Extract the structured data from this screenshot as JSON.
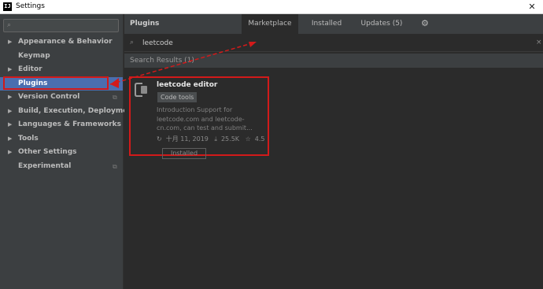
{
  "window": {
    "title": "Settings",
    "icon_label": "IJ"
  },
  "sidebar": {
    "search_placeholder": "",
    "items": [
      {
        "label": "Appearance & Behavior",
        "expandable": true
      },
      {
        "label": "Keymap",
        "expandable": false
      },
      {
        "label": "Editor",
        "expandable": true
      },
      {
        "label": "Plugins",
        "expandable": false,
        "selected": true
      },
      {
        "label": "Version Control",
        "expandable": true,
        "page_icon": true
      },
      {
        "label": "Build, Execution, Deployment",
        "expandable": true
      },
      {
        "label": "Languages & Frameworks",
        "expandable": true
      },
      {
        "label": "Tools",
        "expandable": true
      },
      {
        "label": "Other Settings",
        "expandable": true
      },
      {
        "label": "Experimental",
        "expandable": false,
        "page_icon": true
      }
    ]
  },
  "main": {
    "title": "Plugins",
    "tabs": [
      {
        "label": "Marketplace",
        "active": true
      },
      {
        "label": "Installed",
        "active": false
      },
      {
        "label": "Updates (5)",
        "active": false
      }
    ],
    "search": {
      "value": "leetcode"
    },
    "results_header": "Search Results (1)"
  },
  "plugin": {
    "name": "leetcode editor",
    "tag": "Code tools",
    "description": "Introduction Support for leetcode.com and leetcode-cn.com, can test and submit...",
    "date": "十月 11, 2019",
    "downloads": "25.5K",
    "rating": "4.5",
    "button_label": "Installed"
  },
  "colors": {
    "selection": "#4b6eaf",
    "annotation": "#d21a1a",
    "panel": "#3c3f41",
    "background": "#2b2b2b"
  },
  "icons": [
    "app-icon",
    "close-icon",
    "search-icon",
    "chevron-right-icon",
    "page-icon",
    "gear-icon",
    "plugin-logo-icon",
    "refresh-icon",
    "download-icon",
    "star-icon"
  ]
}
